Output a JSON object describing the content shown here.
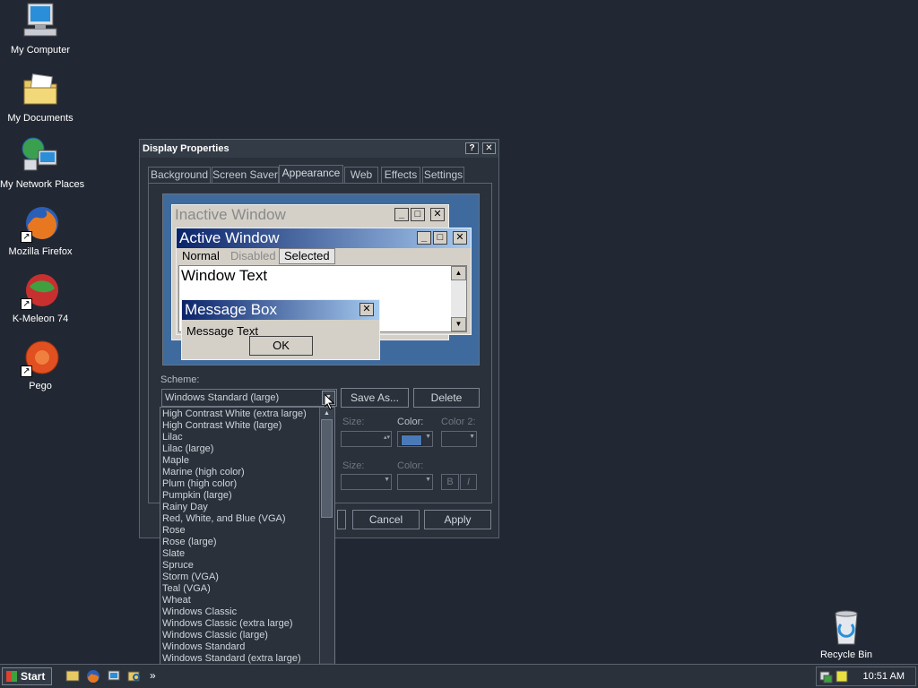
{
  "desktop": {
    "icons": [
      {
        "label": "My Computer",
        "icon": "computer-icon"
      },
      {
        "label": "My Documents",
        "icon": "folder-icon"
      },
      {
        "label": "My Network Places",
        "icon": "network-icon"
      },
      {
        "label": "Mozilla Firefox",
        "icon": "firefox-icon"
      },
      {
        "label": "K-Meleon 74",
        "icon": "kmeleon-icon"
      },
      {
        "label": "Pego",
        "icon": "pego-icon"
      },
      {
        "label": "Recycle Bin",
        "icon": "recycle-bin-icon"
      }
    ]
  },
  "window": {
    "title": "Display Properties",
    "help": "?",
    "close": "✕",
    "tabs": [
      "Background",
      "Screen Saver",
      "Appearance",
      "Web",
      "Effects",
      "Settings"
    ],
    "active_tab": "Appearance"
  },
  "preview": {
    "inactive_title": "Inactive Window",
    "active_title": "Active Window",
    "menu_normal": "Normal",
    "menu_disabled": "Disabled",
    "menu_selected": "Selected",
    "window_text": "Window Text",
    "msg_title": "Message Box",
    "msg_text": "Message Text",
    "ok": "OK"
  },
  "scheme": {
    "label": "Scheme:",
    "value": "Windows Standard (large)",
    "save_as": "Save As...",
    "delete": "Delete",
    "size_label": "Size:",
    "color_label": "Color:",
    "color2_label": "Color 2:",
    "bold_label": "B",
    "italic_label": "I",
    "item_color": "#4a79b8"
  },
  "dropdown": {
    "items": [
      "High Contrast White (extra large)",
      "High Contrast White (large)",
      "Lilac",
      "Lilac (large)",
      "Maple",
      "Marine (high color)",
      "Plum (high color)",
      "Pumpkin (large)",
      "Rainy Day",
      "Red, White, and Blue (VGA)",
      "Rose",
      "Rose (large)",
      "Slate",
      "Spruce",
      "Storm (VGA)",
      "Teal (VGA)",
      "Wheat",
      "Windows Classic",
      "Windows Classic (extra large)",
      "Windows Classic (large)",
      "Windows Standard",
      "Windows Standard (extra large)",
      "Windows Standard (large)"
    ],
    "selected": "Windows Standard (large)"
  },
  "footer": {
    "cancel": "Cancel",
    "apply": "Apply"
  },
  "taskbar": {
    "start": "Start",
    "chevron": "»",
    "clock": "10:51 AM"
  }
}
